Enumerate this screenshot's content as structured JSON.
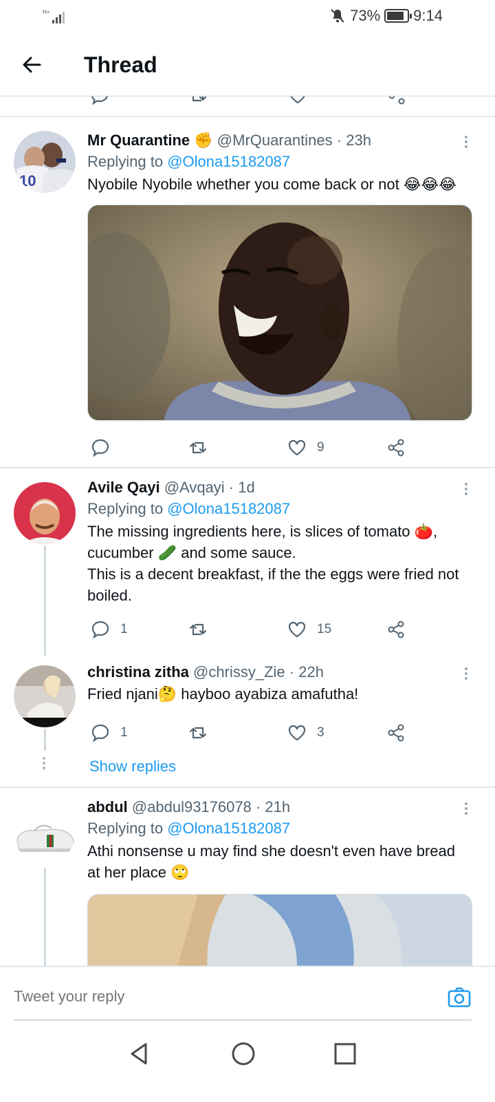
{
  "status_bar": {
    "network": "H+",
    "battery_percent": "73%",
    "battery_level": 0.73,
    "time": "9:14"
  },
  "header": {
    "title": "Thread"
  },
  "tweets": [
    {
      "name": "Mr Quarantine",
      "name_emoji": "✊",
      "handle": "@MrQuarantines",
      "time": "23h",
      "replying_prefix": "Replying to",
      "replying_to": "@Olona15182087",
      "text": "Nyobile Nyobile whether you come back or not",
      "text_emoji": "😂😂😂",
      "likes": "9"
    },
    {
      "name": "Avile Qayi",
      "handle": "@Avqayi",
      "time": "1d",
      "replying_prefix": "Replying to",
      "replying_to": "@Olona15182087",
      "text_line1": "The missing ingredients here, is slices of tomato 🍅,",
      "text_line2": "cucumber 🥒 and some sauce.",
      "text_line3": "This is a decent breakfast, if the the eggs were fried not",
      "text_line4": "boiled.",
      "replies": "1",
      "likes": "15"
    },
    {
      "name": "christina zitha",
      "handle": "@chrissy_Zie",
      "time": "22h",
      "text": "Fried njani🤔 hayboo ayabiza amafutha!",
      "replies": "1",
      "likes": "3"
    },
    {
      "name": "abdul",
      "handle": "@abdul93176078",
      "time": "21h",
      "replying_prefix": "Replying to",
      "replying_to": "@Olona15182087",
      "text_line1": "Athi nonsense u may find she doesn't even have bread",
      "text_line2": "at her place 🙄"
    }
  ],
  "show_replies": "Show replies",
  "composer": {
    "placeholder": "Tweet your reply"
  },
  "colors": {
    "accent": "#1d9bf0",
    "text_primary": "#0f1419",
    "text_secondary": "#536471"
  }
}
